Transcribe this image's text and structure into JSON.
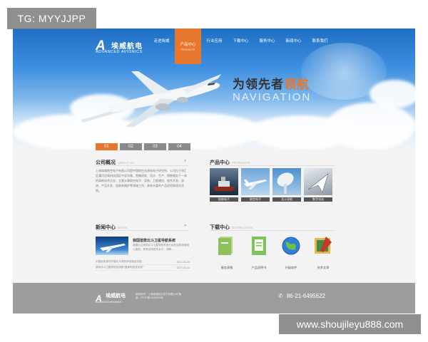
{
  "watermark_top": "TG: MYYJJPP",
  "watermark_bottom": "www.shoujileyu888.com",
  "logo": {
    "mark": "A",
    "name_cn": "埃威航电",
    "name_en": "ADVANCED AVIONICS"
  },
  "nav": [
    {
      "label": "走进埃威",
      "sub": ""
    },
    {
      "label": "产品中心",
      "sub": "PRODUCTS",
      "active": true
    },
    {
      "label": "行业应用",
      "sub": ""
    },
    {
      "label": "下载中心",
      "sub": ""
    },
    {
      "label": "服务中心",
      "sub": ""
    },
    {
      "label": "新闻中心",
      "sub": ""
    },
    {
      "label": "联系我们",
      "sub": ""
    }
  ],
  "hero": {
    "slogan_a": "为领先者",
    "slogan_b": "领航",
    "slogan_en": "NAVIGATION"
  },
  "slider_tabs": [
    "01",
    "02",
    "03",
    "04"
  ],
  "about": {
    "title": "公司概况",
    "title_en": "ABOUT US",
    "text": "上海埃威航空电子有限公司是中国航空无线电电子研究所、公司位于徐汇区漕河泾高科技园区中吴东路，是集研发、设计、生产、销售服务于一体的高新技术企业，主要从事航空电子、导航、卫星通信、软件开发、咨询、产品开发、组装和维护等领域工作，具有丰富的产品经验和领先优势。"
  },
  "products": {
    "title": "产品中心",
    "title_en": "PRODUCTS",
    "items": [
      "船舶电子",
      "航空电子",
      "北斗导航",
      "数字化站"
    ]
  },
  "news": {
    "title": "新闻中心",
    "title_en": "NEWS",
    "headline": "我国首款北斗卫星导航系统",
    "summary": "我国自主研发北斗卫星导航系统已经在民航领域投入使用，具有全球领先水平，详情……",
    "rows": [
      {
        "text": "中国民航首次开展北斗导航系统验证试验",
        "date": "2017-03-20"
      },
      {
        "text": "我司北斗卫星导航系统获“国家科技进步奖”",
        "date": "2017-03-12"
      }
    ]
  },
  "downloads": {
    "title": "下载中心",
    "title_en": "DOWNLOADS",
    "items": [
      {
        "label": "服务表格",
        "icon": "folder-icon"
      },
      {
        "label": "产品说明书",
        "icon": "manual-icon"
      },
      {
        "label": "升级软件",
        "icon": "globe-icon"
      },
      {
        "label": "技术文章",
        "icon": "article-icon"
      }
    ]
  },
  "footer": {
    "logo_cn": "埃威航电",
    "logo_en": "ADVANCED AVIONICS",
    "info": "版权所有：上海埃威航空电子有限公司 备案：沪ICP备12345678号",
    "phone": "86-21-6495622"
  },
  "colors": {
    "accent": "#e8772e",
    "footer": "#9d9d9d",
    "sky": "#3d8fe0"
  }
}
